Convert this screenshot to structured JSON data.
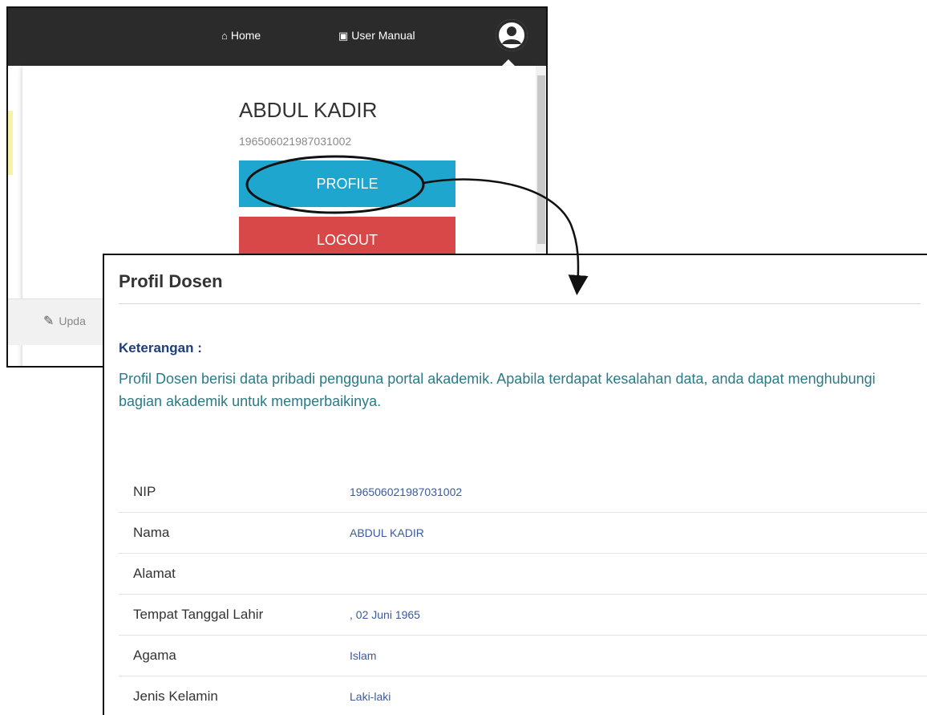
{
  "top_screenshot": {
    "nav": {
      "home_label": "Home",
      "manual_label": "User Manual",
      "user_icon": "user-circle-icon",
      "home_icon": "home-icon",
      "manual_icon": "document-icon"
    },
    "dropdown": {
      "name": "ABDUL KADIR",
      "nip": "196506021987031002",
      "profile_button": "PROFILE",
      "logout_button": "LOGOUT"
    },
    "update_link": "Upda",
    "colors": {
      "navbar": "#2b2b2b",
      "profile_button": "#1fa6cf",
      "logout_button": "#d84848"
    }
  },
  "bottom_screenshot": {
    "title": "Profil Dosen",
    "keterangan_label": "Keterangan :",
    "keterangan_text": "Profil Dosen berisi data pribadi pengguna portal akademik. Apabila terdapat kesalahan data, anda dapat menghubungi bagian akademik untuk memperbaikinya.",
    "fields": [
      {
        "label": "NIP",
        "value": "196506021987031002"
      },
      {
        "label": "Nama",
        "value": "ABDUL KADIR"
      },
      {
        "label": "Alamat",
        "value": ""
      },
      {
        "label": "Tempat Tanggal Lahir",
        "value": ", 02 Juni 1965"
      },
      {
        "label": "Agama",
        "value": "Islam"
      },
      {
        "label": "Jenis Kelamin",
        "value": "Laki-laki"
      }
    ],
    "colors": {
      "keterangan_label": "#1f3f7a",
      "keterangan_text": "#2a7a87",
      "field_value": "#3a5aa0"
    }
  }
}
